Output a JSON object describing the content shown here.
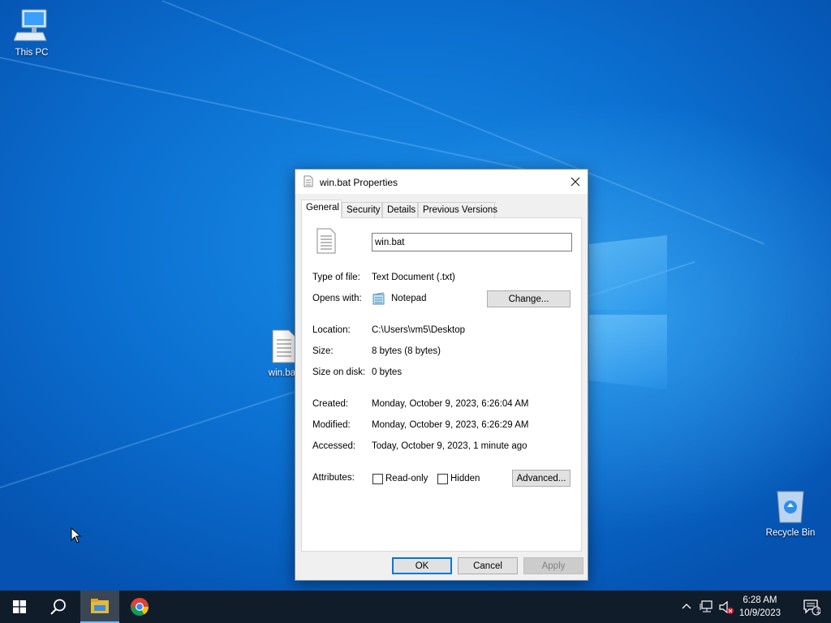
{
  "desktop": {
    "icons": [
      {
        "label": "This PC"
      },
      {
        "label": "win.bat"
      },
      {
        "label": "Recycle Bin"
      }
    ]
  },
  "dialog": {
    "title": "win.bat Properties",
    "tabs": [
      {
        "label": "General",
        "active": true
      },
      {
        "label": "Security",
        "active": false
      },
      {
        "label": "Details",
        "active": false
      },
      {
        "label": "Previous Versions",
        "active": false
      }
    ],
    "general": {
      "file_name": "win.bat",
      "type_label": "Type of file:",
      "type_value": "Text Document (.txt)",
      "opens_label": "Opens with:",
      "opens_value": "Notepad",
      "change_button": "Change...",
      "location_label": "Location:",
      "location_value": "C:\\Users\\vm5\\Desktop",
      "size_label": "Size:",
      "size_value": "8 bytes (8 bytes)",
      "size_disk_label": "Size on disk:",
      "size_disk_value": "0 bytes",
      "created_label": "Created:",
      "created_value": "Monday, October 9, 2023, 6:26:04 AM",
      "modified_label": "Modified:",
      "modified_value": "Monday, October 9, 2023, 6:26:29 AM",
      "accessed_label": "Accessed:",
      "accessed_value": "Today, October 9, 2023, 1 minute ago",
      "attributes_label": "Attributes:",
      "readonly_label": "Read-only",
      "readonly_checked": false,
      "hidden_label": "Hidden",
      "hidden_checked": false,
      "advanced_button": "Advanced..."
    },
    "buttons": {
      "ok": "OK",
      "cancel": "Cancel",
      "apply": "Apply"
    }
  },
  "taskbar": {
    "time": "6:28 AM",
    "date": "10/9/2023",
    "notification_count": "1"
  },
  "colors": {
    "desktop_blue": "#0b6fd0",
    "taskbar": "#101c2a",
    "accent": "#0078d7"
  }
}
